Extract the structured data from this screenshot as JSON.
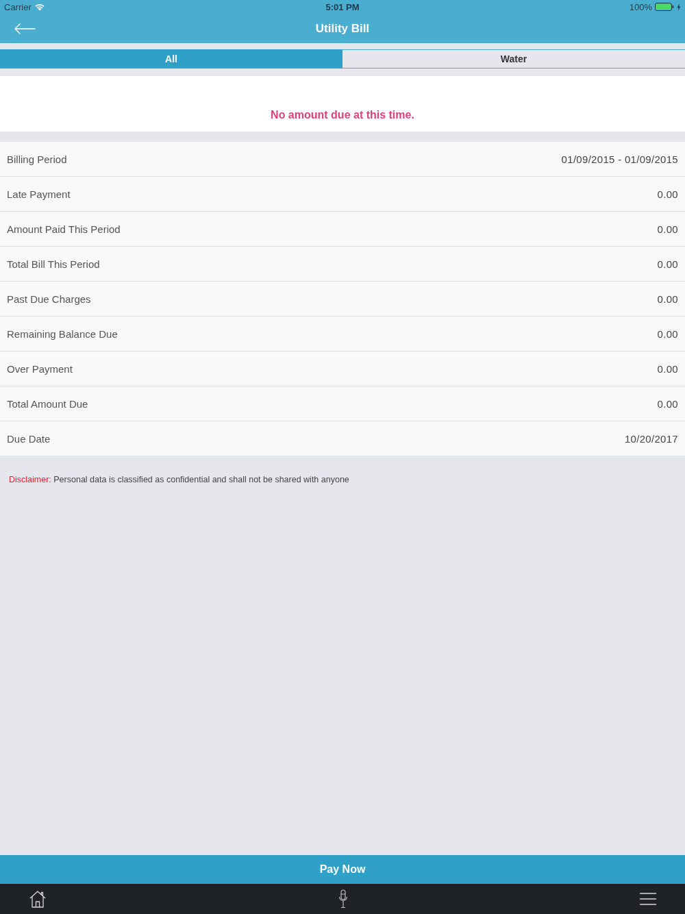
{
  "status_bar": {
    "carrier": "Carrier",
    "time": "5:01 PM",
    "battery": "100%"
  },
  "header": {
    "title": "Utility Bill"
  },
  "tabs": [
    {
      "label": "All",
      "selected": true
    },
    {
      "label": "Water",
      "selected": false
    }
  ],
  "notice": "No amount due at this time.",
  "rows": [
    {
      "label": "Billing Period",
      "value": "01/09/2015 - 01/09/2015"
    },
    {
      "label": "Late Payment",
      "value": "0.00"
    },
    {
      "label": "Amount Paid This Period",
      "value": "0.00"
    },
    {
      "label": "Total Bill This Period",
      "value": "0.00"
    },
    {
      "label": "Past Due Charges",
      "value": "0.00"
    },
    {
      "label": "Remaining Balance Due",
      "value": "0.00"
    },
    {
      "label": "Over Payment",
      "value": "0.00"
    },
    {
      "label": "Total Amount Due",
      "value": "0.00"
    },
    {
      "label": "Due Date",
      "value": "10/20/2017"
    }
  ],
  "disclaimer": "**Disclaimer:** Personal data is classified as confidential and shall not be shared with anyone",
  "pay_button": "Pay Now"
}
